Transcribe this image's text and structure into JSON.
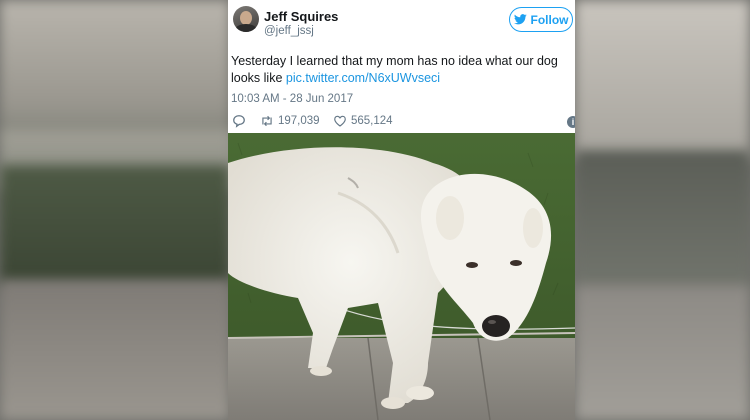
{
  "tweet": {
    "name": "Jeff Squires",
    "handle": "@jeff_jssj",
    "follow_label": "Follow",
    "text_part1": "Yesterday I learned that my mom has no idea what our dog looks like ",
    "link_text": "pic.twitter.com/N6xUWvseci",
    "timestamp": "10:03 AM - 28 Jun 2017",
    "retweets": "197,039",
    "likes": "565,124",
    "info_label": "i"
  },
  "colors": {
    "accent": "#1da1f2",
    "link": "#1b95e0",
    "muted": "#657786"
  },
  "icons": [
    "bird-icon",
    "reply-icon",
    "retweet-icon",
    "heart-icon",
    "info-icon"
  ]
}
